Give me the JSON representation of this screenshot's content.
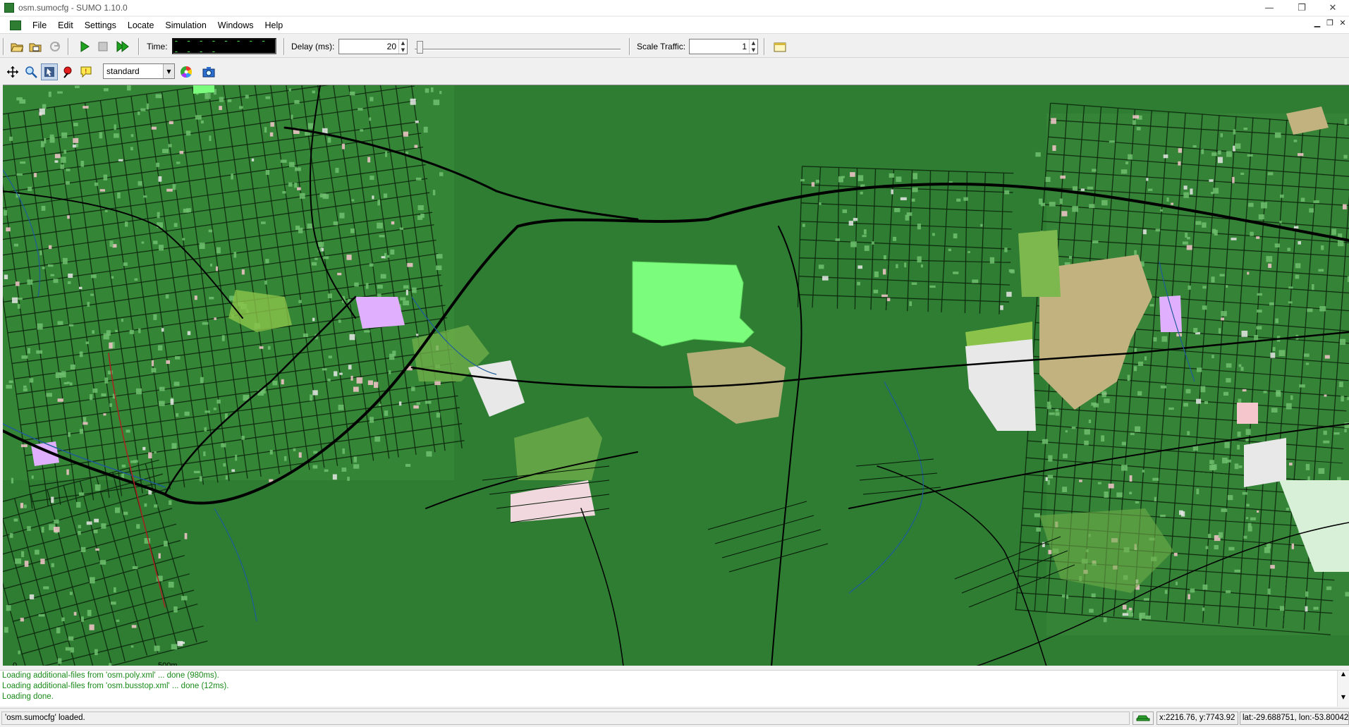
{
  "window": {
    "title": "osm.sumocfg - SUMO 1.10.0",
    "minimize_glyph": "—",
    "maximize_glyph": "❐",
    "close_glyph": "✕",
    "mdi_minimize_glyph": "▁",
    "mdi_restore_glyph": "❐",
    "mdi_close_glyph": "✕"
  },
  "menu": [
    "File",
    "Edit",
    "Settings",
    "Locate",
    "Simulation",
    "Windows",
    "Help"
  ],
  "toolbar": {
    "time_label": "Time:",
    "time_value": "- - - - - - - - - - - -",
    "delay_label": "Delay (ms):",
    "delay_value": "20",
    "delay_slider_fraction": 0.01,
    "scale_label": "Scale Traffic:",
    "scale_value": "1"
  },
  "view_toolbar": {
    "scheme_value": "standard"
  },
  "map": {
    "scale_start": "0",
    "scale_end": "500m",
    "colors": {
      "forest": "#2e7d32",
      "grass": "#8bc34a",
      "meadow": "#7dd87d",
      "bright_meadow": "#7cfc7c",
      "sand": "#c2b280",
      "residential": "#f5c6cb",
      "industrial": "#e8e8e8",
      "road": "#000000",
      "water": "#1e5c9a",
      "lavender": "#e0b0ff"
    }
  },
  "log": {
    "lines": [
      "Loading additional-files from 'osm.poly.xml' ... done (980ms).",
      "Loading additional-files from 'osm.busstop.xml' ... done (12ms).",
      "Loading done."
    ]
  },
  "status": {
    "message": "'osm.sumocfg' loaded.",
    "coords": "x:2216.76, y:7743.92",
    "geo": "lat:-29.688751, lon:-53.800428"
  }
}
